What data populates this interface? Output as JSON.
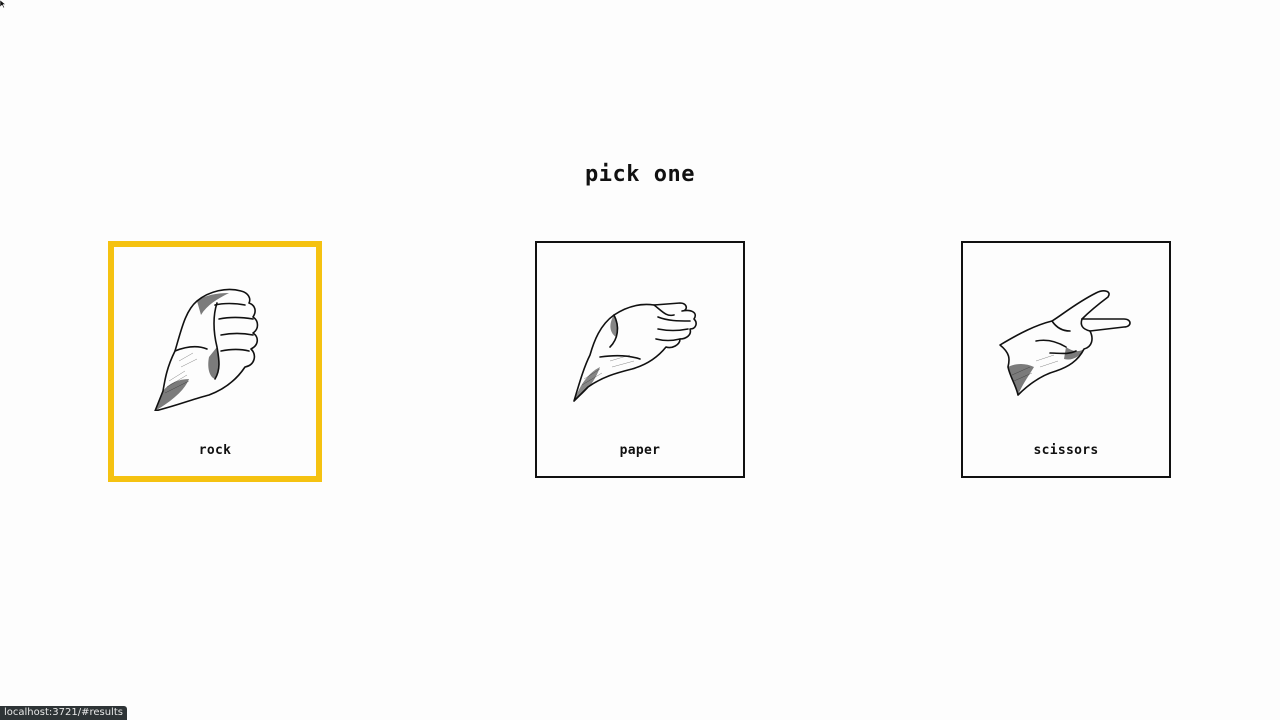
{
  "heading": "pick one",
  "choices": [
    {
      "label": "rock",
      "icon": "rock-fist-icon",
      "selected": true
    },
    {
      "label": "paper",
      "icon": "paper-open-hand-icon",
      "selected": false
    },
    {
      "label": "scissors",
      "icon": "scissors-two-fingers-icon",
      "selected": false
    }
  ],
  "status_url": "localhost:3721/#results",
  "colors": {
    "selected_border": "#f5c211",
    "card_border": "#111111",
    "background": "#fdfdfd",
    "status_bg": "#2e3436"
  }
}
